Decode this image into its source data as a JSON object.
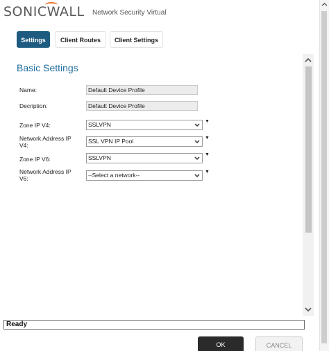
{
  "header": {
    "logo_text_1": "SONIC",
    "logo_text_2": "WALL",
    "subtitle": "Network Security Virtual"
  },
  "tabs": [
    {
      "label": "Settings",
      "active": true
    },
    {
      "label": "Client Routes",
      "active": false
    },
    {
      "label": "Client Settings",
      "active": false
    }
  ],
  "section_title": "Basic Settings",
  "form": {
    "name_label": "Name:",
    "name_value": "Default Device Profile",
    "description_label": "Decription:",
    "description_value": "Default Device Profile",
    "zone_ipv4_label": "Zone IP V4:",
    "zone_ipv4_value": "SSLVPN",
    "net_addr_ipv4_label_1": "Network Address IP",
    "net_addr_ipv4_label_2": "V4:",
    "net_addr_ipv4_value": "SSL VPN IP Pool",
    "zone_ipv6_label": "Zone IP V6:",
    "zone_ipv6_value": "SSLVPN",
    "net_addr_ipv6_label_1": "Network Address IP",
    "net_addr_ipv6_label_2": "V6:",
    "net_addr_ipv6_value": "--Select a network--",
    "required_mark": "▼"
  },
  "status": "Ready",
  "buttons": {
    "ok": "OK",
    "cancel": "CANCEL"
  },
  "colors": {
    "accent": "#1e5b80",
    "title": "#1e6d9e",
    "brand_orange": "#f26b21"
  }
}
